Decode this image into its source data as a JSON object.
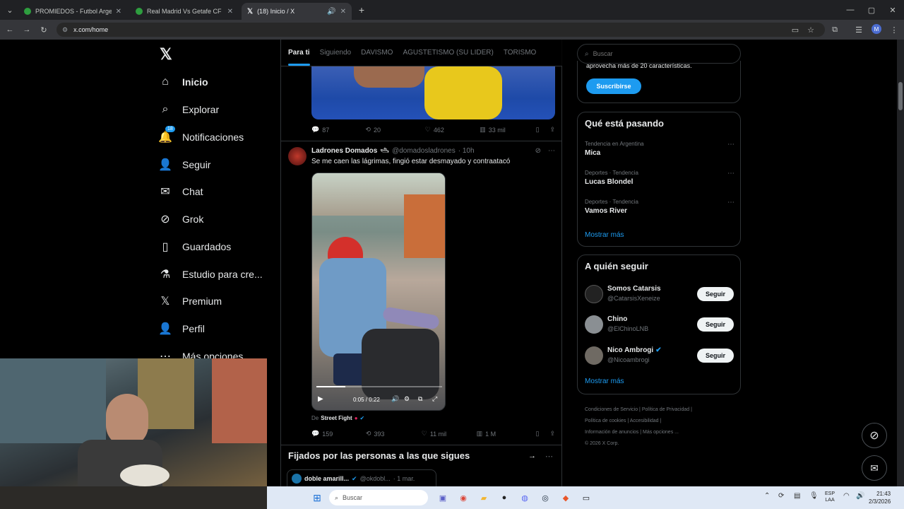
{
  "browser": {
    "tabs": [
      {
        "title": "PROMIEDOS - Futbol Argentino",
        "color": "#2e9e3f"
      },
      {
        "title": "Real Madrid Vs Getafe CF - Res",
        "color": "#2e9e3f"
      },
      {
        "title": "(18) Inicio / X",
        "color": "#ffffff"
      }
    ],
    "url": "x.com/home",
    "profile_initial": "M"
  },
  "x_logo": "𝕏",
  "nav": [
    {
      "label": "Inicio",
      "icon": "home-icon",
      "glyph": "⌂"
    },
    {
      "label": "Explorar",
      "icon": "search-icon",
      "glyph": "⌕"
    },
    {
      "label": "Notificaciones",
      "icon": "bell-icon",
      "glyph": "🔔",
      "badge": "18"
    },
    {
      "label": "Seguir",
      "icon": "person-add-icon",
      "glyph": "👤"
    },
    {
      "label": "Chat",
      "icon": "mail-icon",
      "glyph": "✉"
    },
    {
      "label": "Grok",
      "icon": "grok-icon",
      "glyph": "⊘"
    },
    {
      "label": "Guardados",
      "icon": "bookmark-icon",
      "glyph": "🔖"
    },
    {
      "label": "Estudio para cre...",
      "icon": "flask-icon",
      "glyph": "⚗"
    },
    {
      "label": "Premium",
      "icon": "x-premium-icon",
      "glyph": "𝕏"
    },
    {
      "label": "Perfil",
      "icon": "profile-icon",
      "glyph": "👤"
    },
    {
      "label": "Más opciones",
      "icon": "more-icon",
      "glyph": "⋯"
    }
  ],
  "feed_tabs": [
    "Para ti",
    "Siguiendo",
    "DAVISMO",
    "AGUSTETISMO (SU LIDER)",
    "TORISMO"
  ],
  "post1": {
    "replies": "87",
    "reposts": "20",
    "likes": "462",
    "views": "33 mil"
  },
  "post2": {
    "author": "Ladrones Domados",
    "author_emoji": "🛥",
    "handle": "@domadosladrones",
    "time": "· 10h",
    "text": "Se me caen las lágrimas, fingió estar desmayado y contraatacó",
    "video_time": "0:05 / 0:22",
    "video_progress": 0.23,
    "from_label": "De",
    "from_source": "Street Fight",
    "replies": "159",
    "reposts": "393",
    "likes": "11 mil",
    "views": "1 M"
  },
  "pinned_section": {
    "title": "Fijados por las personas a las que sigues",
    "card_author": "doble amarill...",
    "card_handle": "@okdobl...",
    "card_time": "· 1 mar."
  },
  "search": {
    "placeholder": "Buscar"
  },
  "premium": {
    "text": "aprovecha más de 20 características.",
    "button": "Suscribirse"
  },
  "trending": {
    "title": "Qué está pasando",
    "items": [
      {
        "context": "Tendencia en Argentina",
        "name": "Mica"
      },
      {
        "context": "Deportes · Tendencia",
        "name": "Lucas Blondel"
      },
      {
        "context": "Deportes · Tendencia",
        "name": "Vamos River"
      }
    ],
    "more": "Mostrar más"
  },
  "who_to_follow": {
    "title": "A quién seguir",
    "users": [
      {
        "name": "Somos Catarsis",
        "handle": "@CatarsisXeneize",
        "button": "Seguir"
      },
      {
        "name": "Chino",
        "handle": "@ElChinoLNB",
        "button": "Seguir"
      },
      {
        "name": "Nico Ambrogi",
        "handle": "@Nicoambrogi",
        "button": "Seguir"
      }
    ],
    "more": "Mostrar más"
  },
  "footer": {
    "links": [
      "Condiciones de Servicio",
      "Política de Privacidad",
      "Política de cookies",
      "Accesibilidad",
      "Información de anuncios",
      "Más opciones ..."
    ],
    "copyright": "© 2026 X Corp."
  },
  "taskbar": {
    "search": "Buscar",
    "lang": "ESP",
    "lang2": "LAA",
    "time": "21:43",
    "date": "2/3/2026"
  },
  "colors": {
    "accent": "#1d9bf0",
    "border": "#2f3336"
  }
}
